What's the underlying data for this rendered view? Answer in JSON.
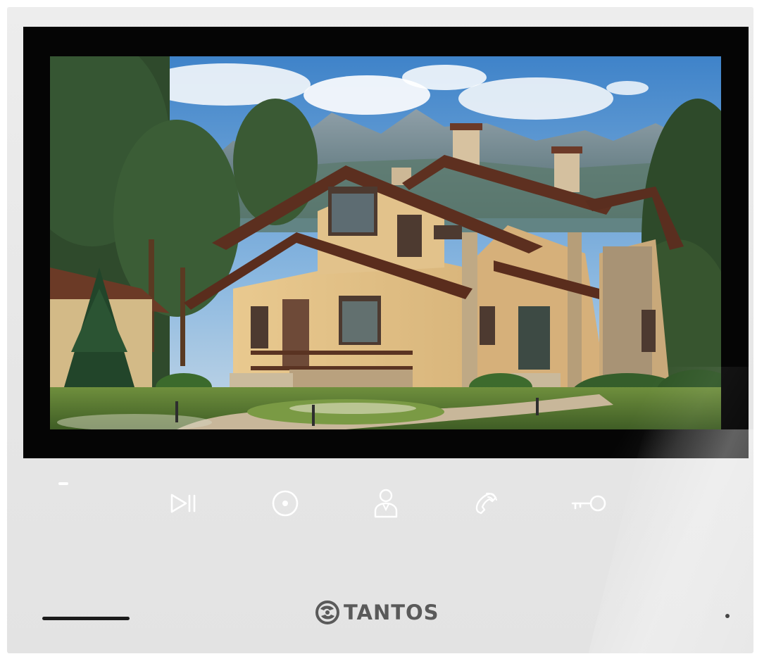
{
  "device": {
    "brand": "TANTOS",
    "colors": {
      "body": "#e8e8e8",
      "bezel": "#050505",
      "button_icon": "#ffffff",
      "logo": "#5a5a5a"
    }
  },
  "screen": {
    "content": "house-landscape-image"
  },
  "buttons": [
    {
      "name": "play-pause-icon"
    },
    {
      "name": "record-icon"
    },
    {
      "name": "user-icon"
    },
    {
      "name": "phone-icon"
    },
    {
      "name": "key-icon"
    }
  ]
}
